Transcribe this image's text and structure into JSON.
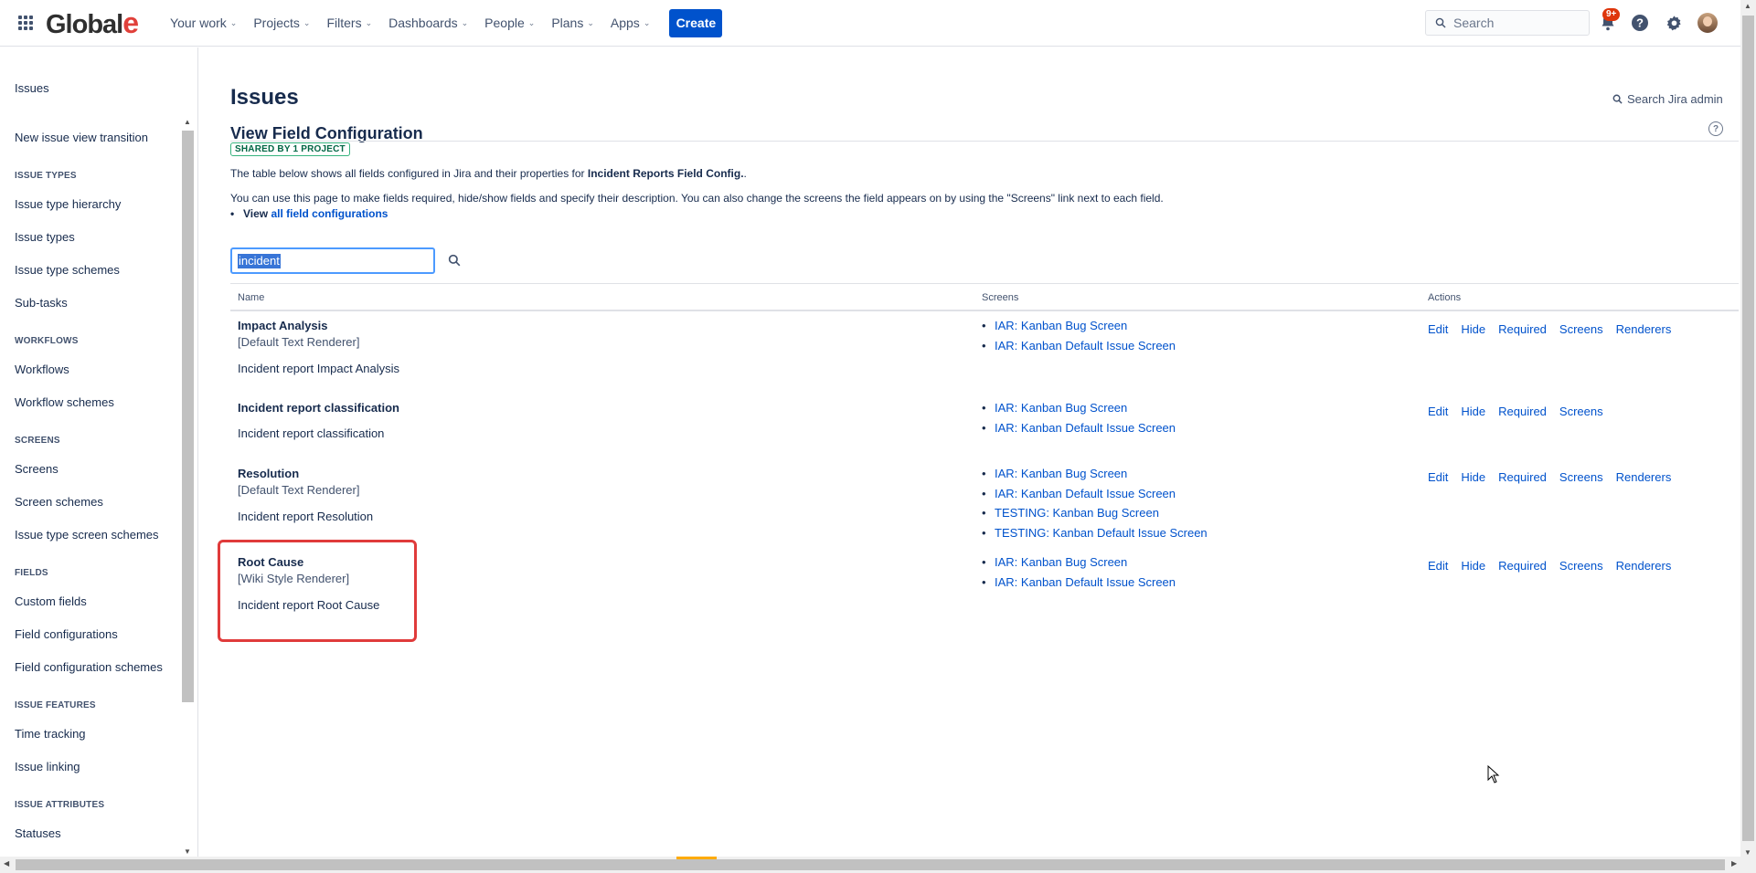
{
  "topnav": {
    "logo_main": "Global",
    "logo_accent": "e",
    "items": [
      {
        "label": "Your work"
      },
      {
        "label": "Projects"
      },
      {
        "label": "Filters"
      },
      {
        "label": "Dashboards"
      },
      {
        "label": "People"
      },
      {
        "label": "Plans"
      },
      {
        "label": "Apps"
      }
    ],
    "create_label": "Create",
    "search_placeholder": "Search",
    "notification_badge": "9+",
    "icons": [
      "app-switcher-icon",
      "notifications-icon",
      "help-icon",
      "settings-icon",
      "avatar"
    ]
  },
  "sidebar": {
    "title": "Issues",
    "link_top": "New issue view transition",
    "sections": [
      {
        "heading": "ISSUE TYPES",
        "items": [
          "Issue type hierarchy",
          "Issue types",
          "Issue type schemes",
          "Sub-tasks"
        ]
      },
      {
        "heading": "WORKFLOWS",
        "items": [
          "Workflows",
          "Workflow schemes"
        ]
      },
      {
        "heading": "SCREENS",
        "items": [
          "Screens",
          "Screen schemes",
          "Issue type screen schemes"
        ]
      },
      {
        "heading": "FIELDS",
        "items": [
          "Custom fields",
          "Field configurations",
          "Field configuration schemes"
        ]
      },
      {
        "heading": "ISSUE FEATURES",
        "items": [
          "Time tracking",
          "Issue linking"
        ]
      },
      {
        "heading": "ISSUE ATTRIBUTES",
        "items": [
          "Statuses"
        ]
      }
    ]
  },
  "main": {
    "page_title": "Issues",
    "admin_search": "Search Jira admin",
    "section_title": "View Field Configuration",
    "shared_lozenge": "SHARED BY 1 PROJECT",
    "desc1_prefix": "The table below shows all fields configured in Jira and their properties for ",
    "desc1_bold": "Incident Reports Field Config.",
    "desc1_suffix": ".",
    "desc2": "You can use this page to make fields required, hide/show fields and specify their description. You can also change the screens the field appears on by using the \"Screens\" link next to each field.",
    "view_prefix": "View ",
    "view_link": "all field configurations",
    "filter_value": "incident",
    "columns": {
      "name": "Name",
      "screens": "Screens",
      "actions": "Actions"
    },
    "rows": [
      {
        "name": "Impact Analysis",
        "renderer": "[Default Text Renderer]",
        "description": "Incident report Impact Analysis",
        "screens": [
          "IAR: Kanban Bug Screen",
          "IAR: Kanban Default Issue Screen"
        ],
        "actions": [
          "Edit",
          "Hide",
          "Required",
          "Screens",
          "Renderers"
        ]
      },
      {
        "name": "Incident report classification",
        "renderer": "",
        "description": "Incident report classification",
        "screens": [
          "IAR: Kanban Bug Screen",
          "IAR: Kanban Default Issue Screen"
        ],
        "actions": [
          "Edit",
          "Hide",
          "Required",
          "Screens"
        ]
      },
      {
        "name": "Resolution",
        "renderer": "[Default Text Renderer]",
        "description": "Incident report Resolution",
        "screens": [
          "IAR: Kanban Bug Screen",
          "IAR: Kanban Default Issue Screen",
          "TESTING: Kanban Bug Screen",
          "TESTING: Kanban Default Issue Screen"
        ],
        "actions": [
          "Edit",
          "Hide",
          "Required",
          "Screens",
          "Renderers"
        ]
      },
      {
        "name": "Root Cause",
        "renderer": "[Wiki Style Renderer]",
        "description": "Incident report Root Cause",
        "screens": [
          "IAR: Kanban Bug Screen",
          "IAR: Kanban Default Issue Screen"
        ],
        "actions": [
          "Edit",
          "Hide",
          "Required",
          "Screens",
          "Renderers"
        ]
      }
    ],
    "highlight_color": "#e03b3b"
  }
}
